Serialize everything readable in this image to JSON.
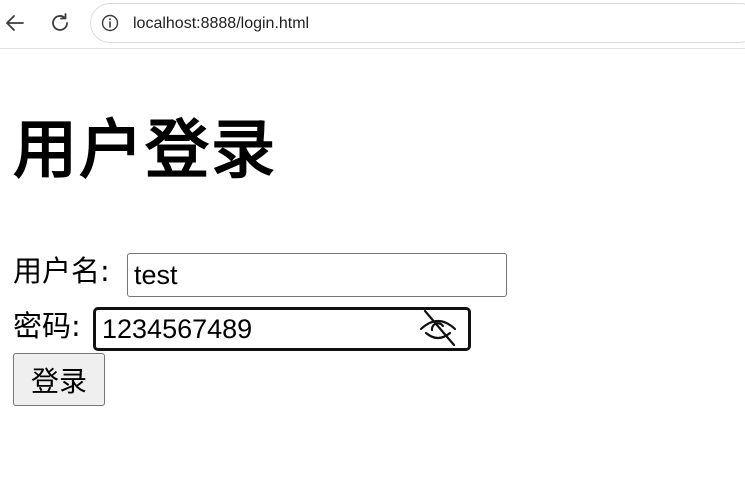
{
  "browser": {
    "url": "localhost:8888/login.html",
    "back_icon": "arrow-left-icon",
    "reload_icon": "reload-icon",
    "site_info_icon": "info-circle-icon"
  },
  "page": {
    "title": "用户登录",
    "username_label": "用户名:",
    "username_value": "test",
    "password_label": "密码:",
    "password_value": "1234567489",
    "password_toggle_icon": "eye-slash-icon",
    "submit_label": "登录"
  }
}
